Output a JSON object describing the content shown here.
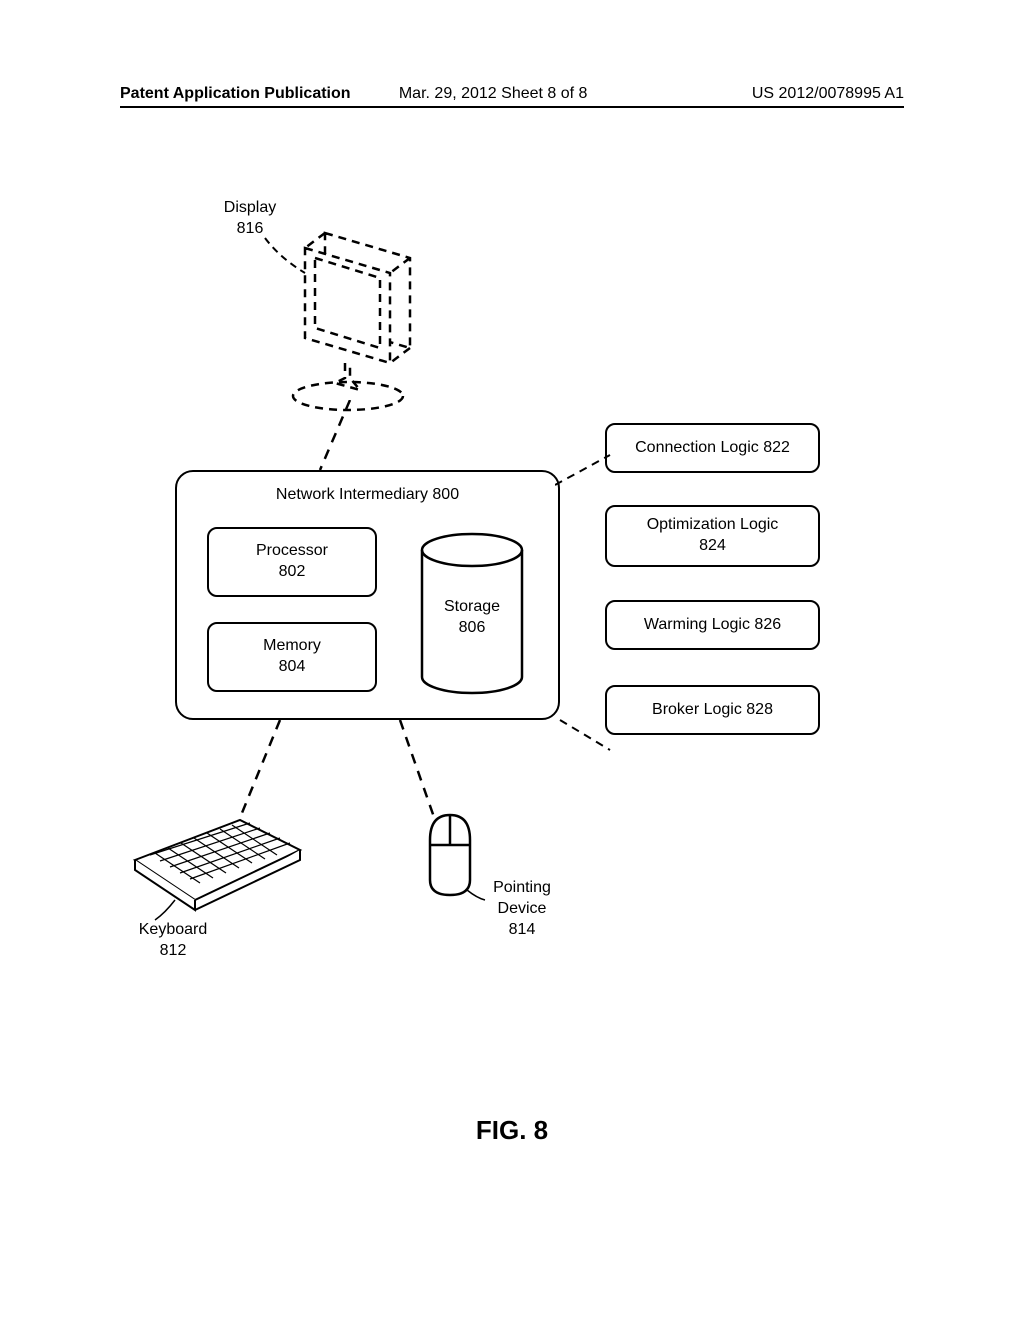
{
  "header": {
    "left": "Patent Application Publication",
    "center": "Mar. 29, 2012  Sheet 8 of 8",
    "right": "US 2012/0078995 A1"
  },
  "display": {
    "label": "Display",
    "ref": "816"
  },
  "main": {
    "title": "Network Intermediary 800",
    "processor": {
      "label": "Processor",
      "ref": "802"
    },
    "memory": {
      "label": "Memory",
      "ref": "804"
    },
    "storage": {
      "label": "Storage",
      "ref": "806"
    }
  },
  "logic": {
    "connection": "Connection Logic 822",
    "optimization": {
      "label": "Optimization Logic",
      "ref": "824"
    },
    "warming": "Warming Logic 826",
    "broker": "Broker Logic 828"
  },
  "keyboard": {
    "label": "Keyboard",
    "ref": "812"
  },
  "pointing": {
    "label": "Pointing",
    "label2": "Device",
    "ref": "814"
  },
  "figure": "FIG. 8"
}
